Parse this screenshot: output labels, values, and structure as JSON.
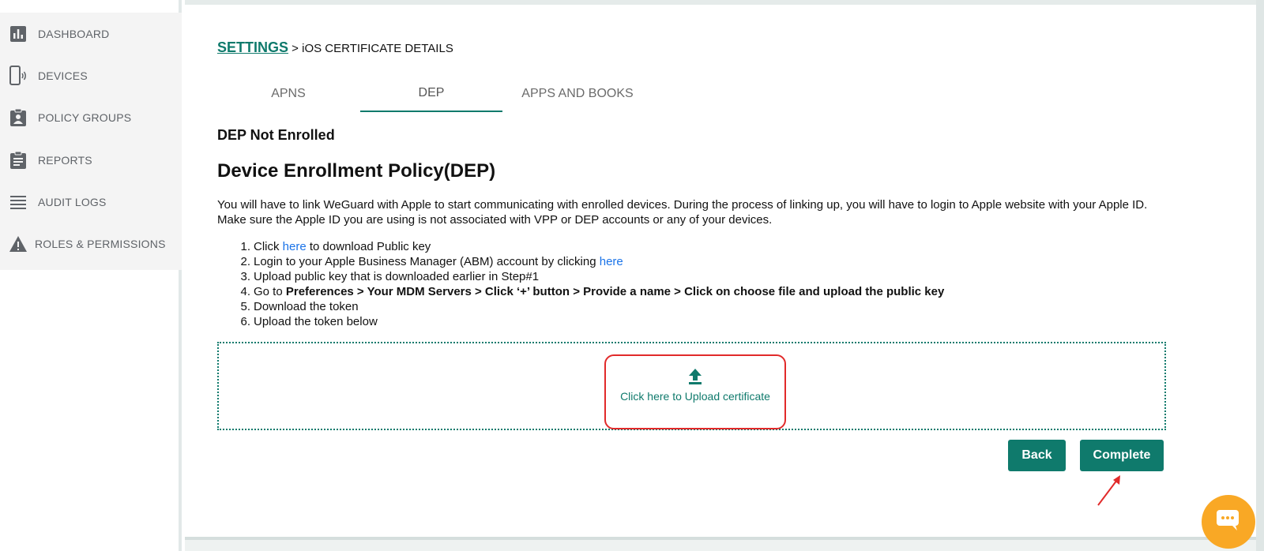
{
  "sidebar": {
    "items": [
      {
        "label": "DASHBOARD",
        "icon": "bar-chart-icon"
      },
      {
        "label": "DEVICES",
        "icon": "phone-icon"
      },
      {
        "label": "POLICY GROUPS",
        "icon": "clipboard-user-icon"
      },
      {
        "label": "REPORTS",
        "icon": "clipboard-list-icon"
      },
      {
        "label": "AUDIT LOGS",
        "icon": "lines-icon"
      },
      {
        "label": "ROLES & PERMISSIONS",
        "icon": "warning-icon"
      }
    ]
  },
  "breadcrumb": {
    "root": "SETTINGS",
    "separator": " > ",
    "current": "iOS CERTIFICATE DETAILS"
  },
  "tabs": [
    {
      "label": "APNS",
      "active": false
    },
    {
      "label": "DEP",
      "active": true
    },
    {
      "label": "APPS AND BOOKS",
      "active": false
    }
  ],
  "content": {
    "status": "DEP Not Enrolled",
    "title": "Device Enrollment Policy(DEP)",
    "intro": "You will have to link WeGuard with Apple to start communicating with enrolled devices. During the process of linking up, you will have to login to Apple website with your Apple ID. Make sure the Apple ID you are using is not associated with VPP or DEP accounts or any of your devices.",
    "steps": {
      "s1_num": "1.",
      "s1_pre": "Click ",
      "s1_link": "here",
      "s1_post": " to download Public key",
      "s2_num": "2.",
      "s2_pre": "Login to your Apple Business Manager (ABM) account by clicking ",
      "s2_link": "here",
      "s3_num": "3.",
      "s3_text": "Upload public key that is downloaded earlier in Step#1",
      "s4_num": "4.",
      "s4_pre": "Go to ",
      "s4_bold": "Preferences > Your MDM Servers > Click ‘+’ button > Provide a name > Click on choose file and upload the public key",
      "s5_num": "5.",
      "s5_text": "Download the token",
      "s6_num": "6.",
      "s6_text": "Upload the token below"
    }
  },
  "upload": {
    "label": "Click here to Upload certificate",
    "icon": "upload-icon"
  },
  "actions": {
    "back_label": "Back",
    "complete_label": "Complete"
  },
  "chat": {
    "icon": "chat-icon"
  },
  "colors": {
    "accent": "#0f7a6c",
    "link": "#1a73e8",
    "highlight": "#e12a2a",
    "chat": "#f9a825"
  }
}
